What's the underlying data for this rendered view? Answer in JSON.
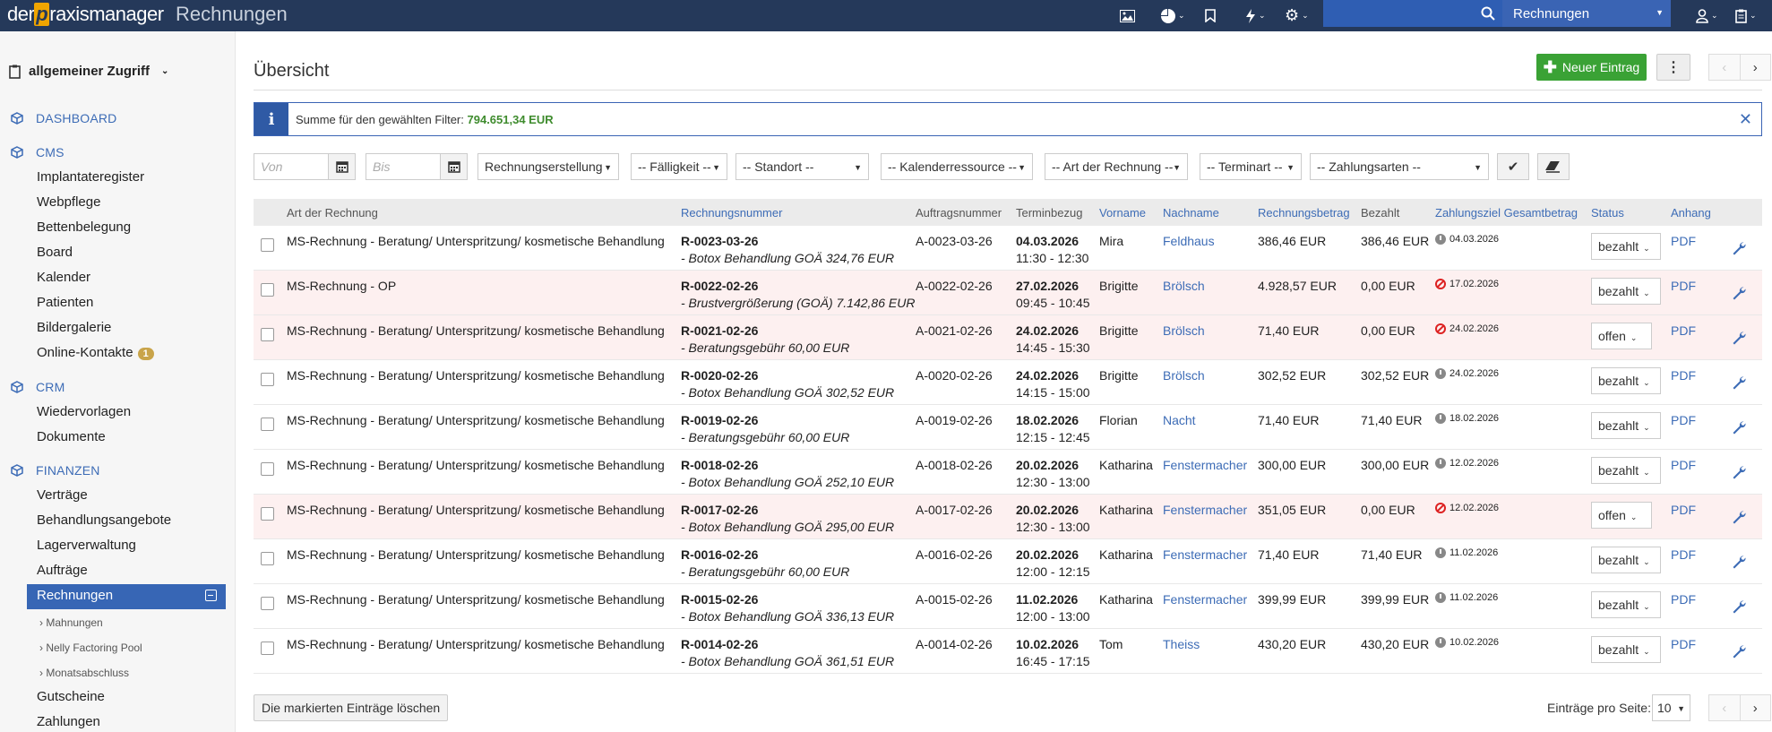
{
  "app": {
    "logo_pre": "der",
    "logo_p": "p",
    "logo_post": "raxismanager",
    "page_heading": "Rechnungen"
  },
  "topbar": {
    "search_scope": "Rechnungen",
    "icons": [
      "image-icon",
      "pie-chart-icon",
      "bookmark-icon",
      "bolt-icon",
      "gear-icon",
      "search-icon",
      "user-icon",
      "clipboard-icon"
    ]
  },
  "sidebar": {
    "org": "allgemeiner Zugriff",
    "sections": {
      "dashboard": "DASHBOARD",
      "cms": "CMS",
      "crm": "CRM",
      "finanzen": "FINANZEN"
    },
    "cms_items": [
      "Implantateregister",
      "Webpflege",
      "Bettenbelegung",
      "Board",
      "Kalender",
      "Patienten",
      "Bildergalerie",
      "Online-Kontakte"
    ],
    "online_badge": "1",
    "crm_items": [
      "Wiedervorlagen",
      "Dokumente"
    ],
    "fin_items": [
      "Verträge",
      "Behandlungsangebote",
      "Lagerverwaltung",
      "Aufträge",
      "Rechnungen"
    ],
    "sub_items": [
      "Mahnungen",
      "Nelly Factoring Pool",
      "Monatsabschluss"
    ],
    "fin_items2": [
      "Gutscheine",
      "Zahlungen"
    ]
  },
  "main": {
    "title": "Übersicht",
    "new_button": "Neuer Eintrag",
    "info_text": "Summe für den gewählten Filter:",
    "info_sum": "794.651,34 EUR"
  },
  "filters": {
    "von_placeholder": "Von",
    "bis_placeholder": "Bis",
    "rechnungserstellung": "Rechnungserstellung",
    "faelligkeit": "-- Fälligkeit --",
    "standort": "-- Standort --",
    "kalenderressource": "-- Kalenderressource --",
    "art": "-- Art der Rechnung --",
    "terminart": "-- Terminart --",
    "zahlungsarten": "-- Zahlungsarten --"
  },
  "table": {
    "headers": {
      "art": "Art der Rechnung",
      "nummer": "Rechnungsnummer",
      "auftrag": "Auftragsnummer",
      "termin": "Terminbezug",
      "vorname": "Vorname",
      "nachname": "Nachname",
      "betrag": "Rechnungsbetrag",
      "bezahlt": "Bezahlt",
      "ziel": "Zahlungsziel Gesamtbetrag",
      "status": "Status",
      "anhang": "Anhang"
    },
    "rows": [
      {
        "art": "MS-Rechnung - Beratung/ Unterspritzung/ kosmetische Behandlung",
        "nr": "R-0023-03-26",
        "pos": "- Botox Behandlung GOÄ 324,76 EUR",
        "auftrag": "A-0023-03-26",
        "datum": "04.03.2026",
        "zeit": "11:30 - 12:30",
        "vorname": "Mira",
        "nachname": "Feldhaus",
        "betrag": "386,46 EUR",
        "bezahlt": "386,46 EUR",
        "ziel": "04.03.2026",
        "status": "bezahlt",
        "anhang": "PDF"
      },
      {
        "art": "MS-Rechnung - OP",
        "nr": "R-0022-02-26",
        "pos": "- Brustvergrößerung (GOÄ) 7.142,86 EUR",
        "auftrag": "A-0022-02-26",
        "datum": "27.02.2026",
        "zeit": "09:45 - 10:45",
        "vorname": "Brigitte",
        "nachname": "Brölsch",
        "betrag": "4.928,57 EUR",
        "bezahlt": "0,00 EUR",
        "ziel": "17.02.2026",
        "status": "bezahlt",
        "anhang": "PDF"
      },
      {
        "art": "MS-Rechnung - Beratung/ Unterspritzung/ kosmetische Behandlung",
        "nr": "R-0021-02-26",
        "pos": "- Beratungsgebühr 60,00 EUR",
        "auftrag": "A-0021-02-26",
        "datum": "24.02.2026",
        "zeit": "14:45 - 15:30",
        "vorname": "Brigitte",
        "nachname": "Brölsch",
        "betrag": "71,40 EUR",
        "bezahlt": "0,00 EUR",
        "ziel": "24.02.2026",
        "status": "offen",
        "anhang": "PDF"
      },
      {
        "art": "MS-Rechnung - Beratung/ Unterspritzung/ kosmetische Behandlung",
        "nr": "R-0020-02-26",
        "pos": "- Botox Behandlung GOÄ 302,52 EUR",
        "auftrag": "A-0020-02-26",
        "datum": "24.02.2026",
        "zeit": "14:15 - 15:00",
        "vorname": "Brigitte",
        "nachname": "Brölsch",
        "betrag": "302,52 EUR",
        "bezahlt": "302,52 EUR",
        "ziel": "24.02.2026",
        "status": "bezahlt",
        "anhang": "PDF"
      },
      {
        "art": "MS-Rechnung - Beratung/ Unterspritzung/ kosmetische Behandlung",
        "nr": "R-0019-02-26",
        "pos": "- Beratungsgebühr 60,00 EUR",
        "auftrag": "A-0019-02-26",
        "datum": "18.02.2026",
        "zeit": "12:15 - 12:45",
        "vorname": "Florian",
        "nachname": "Nacht",
        "betrag": "71,40 EUR",
        "bezahlt": "71,40 EUR",
        "ziel": "18.02.2026",
        "status": "bezahlt",
        "anhang": "PDF"
      },
      {
        "art": "MS-Rechnung - Beratung/ Unterspritzung/ kosmetische Behandlung",
        "nr": "R-0018-02-26",
        "pos": "- Botox Behandlung GOÄ 252,10 EUR",
        "auftrag": "A-0018-02-26",
        "datum": "20.02.2026",
        "zeit": "12:30 - 13:00",
        "vorname": "Katharina",
        "nachname": "Fenstermacher",
        "betrag": "300,00 EUR",
        "bezahlt": "300,00 EUR",
        "ziel": "12.02.2026",
        "status": "bezahlt",
        "anhang": "PDF"
      },
      {
        "art": "MS-Rechnung - Beratung/ Unterspritzung/ kosmetische Behandlung",
        "nr": "R-0017-02-26",
        "pos": "- Botox Behandlung GOÄ 295,00 EUR",
        "auftrag": "A-0017-02-26",
        "datum": "20.02.2026",
        "zeit": "12:30 - 13:00",
        "vorname": "Katharina",
        "nachname": "Fenstermacher",
        "betrag": "351,05 EUR",
        "bezahlt": "0,00 EUR",
        "ziel": "12.02.2026",
        "status": "offen",
        "anhang": "PDF"
      },
      {
        "art": "MS-Rechnung - Beratung/ Unterspritzung/ kosmetische Behandlung",
        "nr": "R-0016-02-26",
        "pos": "- Beratungsgebühr 60,00 EUR",
        "auftrag": "A-0016-02-26",
        "datum": "20.02.2026",
        "zeit": "12:00 - 12:15",
        "vorname": "Katharina",
        "nachname": "Fenstermacher",
        "betrag": "71,40 EUR",
        "bezahlt": "71,40 EUR",
        "ziel": "11.02.2026",
        "status": "bezahlt",
        "anhang": "PDF"
      },
      {
        "art": "MS-Rechnung - Beratung/ Unterspritzung/ kosmetische Behandlung",
        "nr": "R-0015-02-26",
        "pos": "- Botox Behandlung GOÄ 336,13 EUR",
        "auftrag": "A-0015-02-26",
        "datum": "11.02.2026",
        "zeit": "12:00 - 13:00",
        "vorname": "Katharina",
        "nachname": "Fenstermacher",
        "betrag": "399,99 EUR",
        "bezahlt": "399,99 EUR",
        "ziel": "11.02.2026",
        "status": "bezahlt",
        "anhang": "PDF"
      },
      {
        "art": "MS-Rechnung - Beratung/ Unterspritzung/ kosmetische Behandlung",
        "nr": "R-0014-02-26",
        "pos": "- Botox Behandlung GOÄ 361,51 EUR",
        "auftrag": "A-0014-02-26",
        "datum": "10.02.2026",
        "zeit": "16:45 - 17:15",
        "vorname": "Tom",
        "nachname": "Theiss",
        "betrag": "430,20 EUR",
        "bezahlt": "430,20 EUR",
        "ziel": "10.02.2026",
        "status": "bezahlt",
        "anhang": "PDF"
      }
    ],
    "overdue_rows": [
      1,
      2,
      6
    ]
  },
  "footer": {
    "delete_button": "Die markierten Einträge löschen",
    "per_page_label": "Einträge pro Seite:",
    "per_page_value": "10"
  },
  "colors": {
    "topbar": "#25395a",
    "accent": "#3766b5",
    "green": "#3aa235",
    "overdue_bg": "#fdf0f0"
  }
}
